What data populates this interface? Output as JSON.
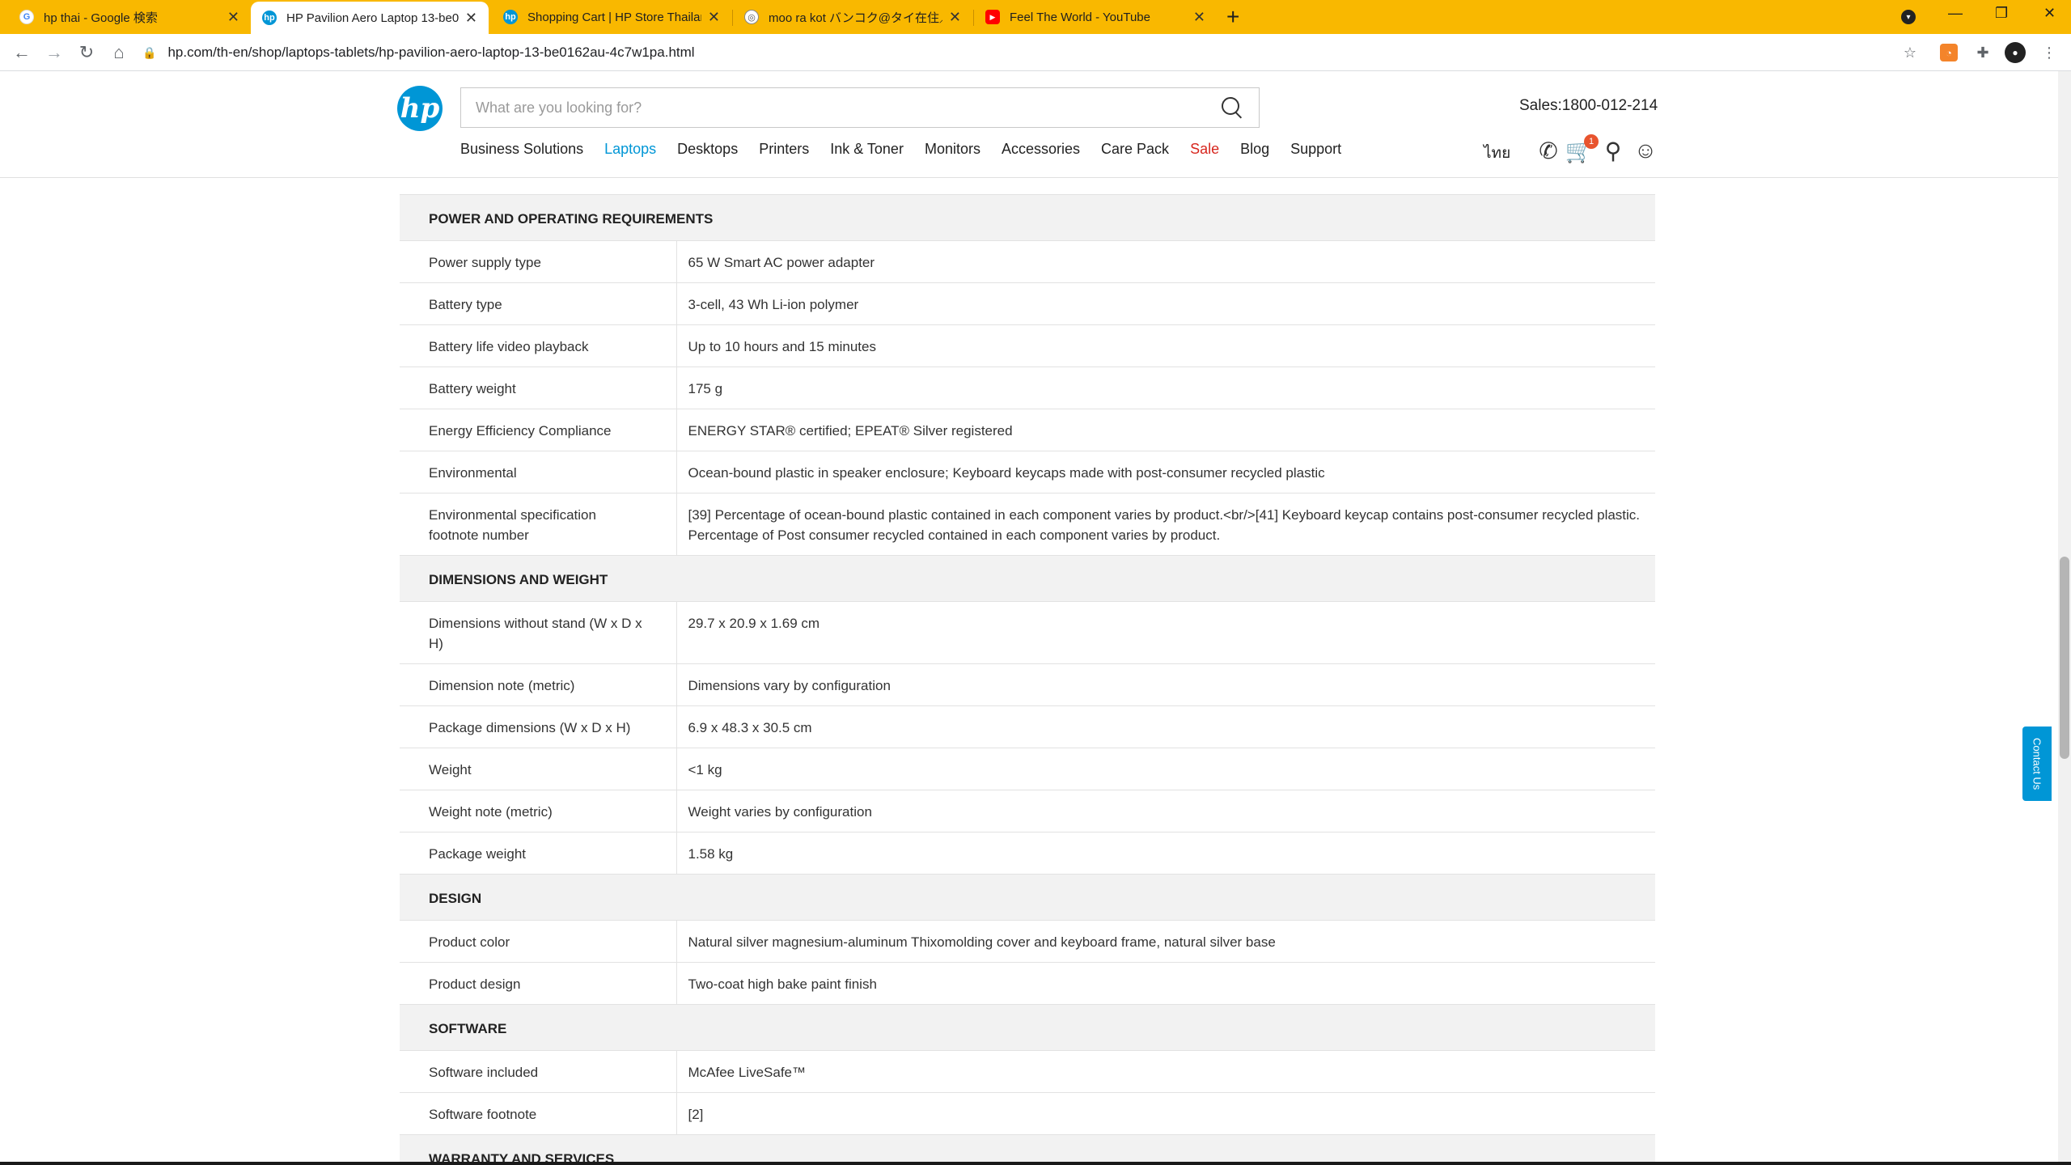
{
  "browser": {
    "tabs": [
      {
        "title": "hp thai - Google 検索",
        "favicon": "google-icon"
      },
      {
        "title": "HP Pavilion Aero Laptop 13-be0",
        "favicon": "hp-icon"
      },
      {
        "title": "Shopping Cart | HP Store Thailan",
        "favicon": "hp-icon"
      },
      {
        "title": "moo ra kot バンコク@タイ在住／",
        "favicon": "globe-icon"
      },
      {
        "title": "Feel The World - YouTube",
        "favicon": "youtube-icon"
      }
    ],
    "url": "hp.com/th-en/shop/laptops-tablets/hp-pavilion-aero-laptop-13-be0162au-4c7w1pa.html"
  },
  "header": {
    "logo": "hp",
    "search_placeholder": "What are you looking for?",
    "sales": "Sales:1800-012-214",
    "nav": [
      "Business Solutions",
      "Laptops",
      "Desktops",
      "Printers",
      "Ink & Toner",
      "Monitors",
      "Accessories",
      "Care Pack",
      "Sale",
      "Blog",
      "Support"
    ],
    "language": "ไทย",
    "cart_count": "1"
  },
  "sections": [
    {
      "title": "POWER AND OPERATING REQUIREMENTS",
      "rows": [
        {
          "k": "Power supply type",
          "v": "65 W Smart AC power adapter"
        },
        {
          "k": "Battery type",
          "v": "3-cell, 43 Wh Li-ion polymer"
        },
        {
          "k": "Battery life video playback",
          "v": "Up to 10 hours and 15 minutes"
        },
        {
          "k": "Battery weight",
          "v": "175 g"
        },
        {
          "k": "Energy Efficiency Compliance",
          "v": "ENERGY STAR® certified; EPEAT® Silver registered"
        },
        {
          "k": "Environmental",
          "v": "Ocean-bound plastic in speaker enclosure; Keyboard keycaps made with post-consumer recycled plastic"
        },
        {
          "k": "Environmental specification footnote number",
          "v": "[39] Percentage of ocean-bound plastic contained in each component varies by product.<br/>[41] Keyboard keycap contains post-consumer recycled plastic. Percentage of Post consumer recycled contained in each component varies by product."
        }
      ]
    },
    {
      "title": "DIMENSIONS AND WEIGHT",
      "rows": [
        {
          "k": "Dimensions without stand (W x D x H)",
          "v": "29.7 x 20.9 x 1.69 cm"
        },
        {
          "k": "Dimension note (metric)",
          "v": "Dimensions vary by configuration"
        },
        {
          "k": "Package dimensions (W x D x H)",
          "v": "6.9 x 48.3 x 30.5 cm"
        },
        {
          "k": "Weight",
          "v": "<1 kg"
        },
        {
          "k": "Weight note (metric)",
          "v": "Weight varies by configuration"
        },
        {
          "k": "Package weight",
          "v": "1.58 kg"
        }
      ]
    },
    {
      "title": "DESIGN",
      "rows": [
        {
          "k": "Product color",
          "v": "Natural silver magnesium-aluminum Thixomolding cover and keyboard frame, natural silver base"
        },
        {
          "k": "Product design",
          "v": "Two-coat high bake paint finish"
        }
      ]
    },
    {
      "title": "SOFTWARE",
      "rows": [
        {
          "k": "Software included",
          "v": "McAfee LiveSafe™"
        },
        {
          "k": "Software footnote",
          "v": "[2]"
        }
      ]
    },
    {
      "title": "WARRANTY AND SERVICES",
      "rows": []
    }
  ],
  "contact_tab": "Contact Us",
  "colors": {
    "tab_strip": "#f9b800",
    "hp_blue": "#0096d6",
    "sale_red": "#d7261e"
  }
}
